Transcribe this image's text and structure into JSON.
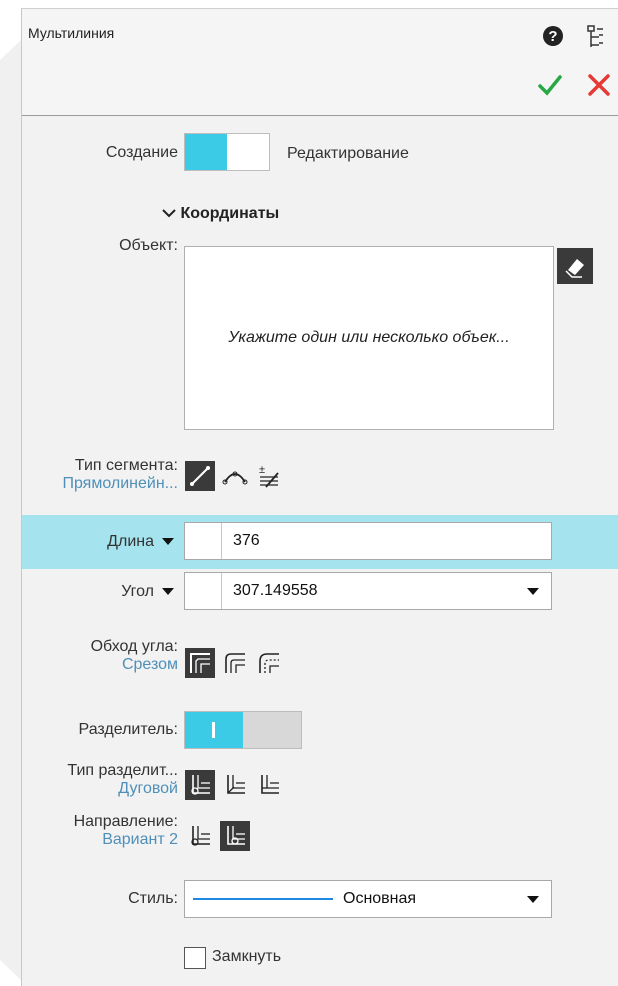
{
  "title": "Мультилиния",
  "header_icons": [
    "help-icon",
    "tree-icon",
    "checkmark-icon",
    "close-icon"
  ],
  "mode": {
    "create_label": "Создание",
    "edit_label": "Редактирование",
    "selected": "create"
  },
  "section": {
    "label": "Координаты"
  },
  "object": {
    "label": "Объект:",
    "hint": "Укажите один или несколько объек..."
  },
  "segment_type": {
    "label": "Тип сегмента:",
    "value": "Прямолинейн...",
    "icons": [
      "line-segment-icon",
      "arc-segment-icon",
      "add-segment-icon"
    ]
  },
  "length": {
    "label": "Длина",
    "value": "376"
  },
  "angle": {
    "label": "Угол",
    "value": "307.149558"
  },
  "corner": {
    "label": "Обход угла:",
    "value": "Срезом"
  },
  "separator": {
    "label": "Разделитель:",
    "state": "on"
  },
  "separator_type": {
    "label": "Тип разделит...",
    "value": "Дуговой"
  },
  "direction": {
    "label": "Направление:",
    "value": "Вариант 2"
  },
  "style": {
    "label": "Стиль:",
    "value": "Основная",
    "line_color": "#1e88e5"
  },
  "close": {
    "label": "Замкнуть",
    "checked": false
  },
  "colors": {
    "accent": "#3ccbe6",
    "highlight": "#a5e3ee",
    "ok": "#27a844",
    "cancel": "#e53935"
  }
}
